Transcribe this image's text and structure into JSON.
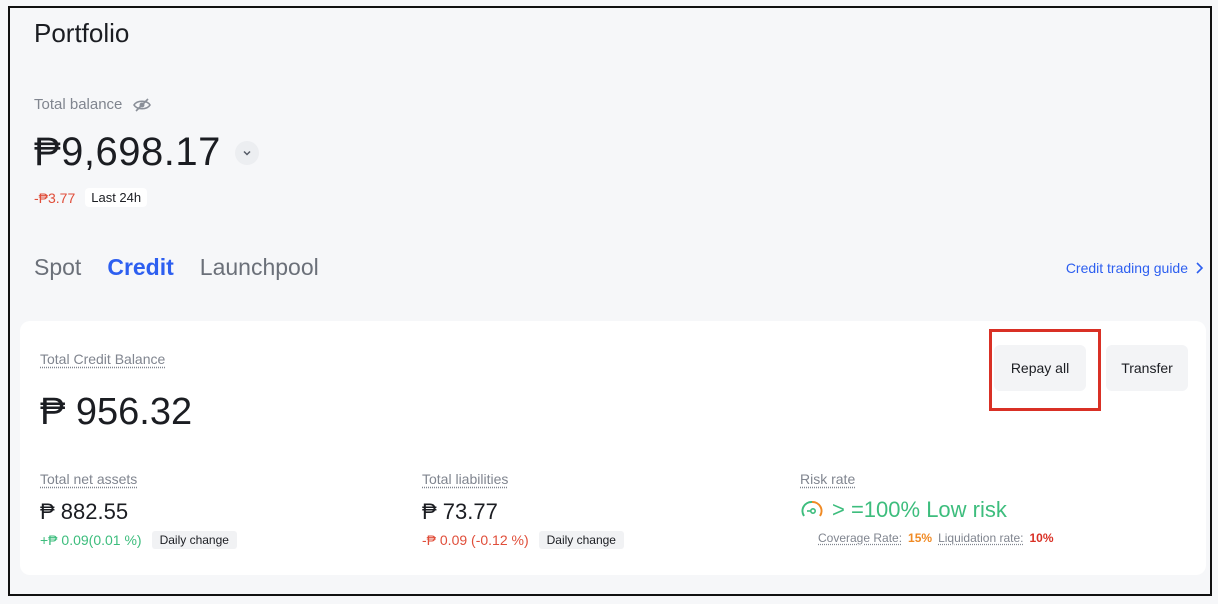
{
  "page": {
    "title": "Portfolio"
  },
  "balance": {
    "label": "Total balance",
    "value": "₱9,698.17",
    "change": "-₱3.77",
    "period": "Last 24h"
  },
  "tabs": [
    {
      "label": "Spot"
    },
    {
      "label": "Credit"
    },
    {
      "label": "Launchpool"
    }
  ],
  "guide_link": {
    "label": "Credit trading guide"
  },
  "credit": {
    "total_label": "Total Credit Balance",
    "total_value": "₱ 956.32",
    "repay_label": "Repay all",
    "transfer_label": "Transfer",
    "net_assets": {
      "label": "Total net assets",
      "value": "₱ 882.55",
      "change": "+₱ 0.09(0.01 %)",
      "change_label": "Daily change"
    },
    "liabilities": {
      "label": "Total liabilities",
      "value": "₱ 73.77",
      "change": "-₱ 0.09 (-0.12 %)",
      "change_label": "Daily change"
    },
    "risk": {
      "label": "Risk rate",
      "value": "> =100% Low risk",
      "coverage_label": "Coverage Rate:",
      "coverage_value": "15%",
      "liquidation_label": "Liquidation rate:",
      "liquidation_value": "10%"
    }
  },
  "colors": {
    "accent": "#2d5ff0",
    "positive": "#3dbd7d",
    "negative": "#e04e3a",
    "highlight": "#d93025"
  },
  "icons": [
    "eye-hidden-icon",
    "chevron-down-icon",
    "chevron-right-icon",
    "gauge-icon"
  ]
}
